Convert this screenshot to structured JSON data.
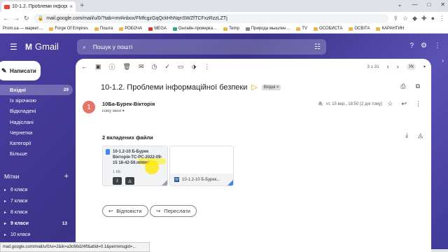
{
  "browser": {
    "tab_title": "10-1.2. Проблеми інформаційної",
    "tab_close": "×",
    "new_tab": "+",
    "url": "mail.google.com/mail/u/0/?tab=rm#inbox/FMfcgzGqQckHhNqnSWZfTCFxzRzzLZTj",
    "window_controls": [
      "⌄",
      "—",
      "□",
      "✕"
    ],
    "bookmarks": [
      "Prom.ua — маркет…",
      "Forge Of Empires",
      "Пошта",
      "РОБОЧА",
      "MEGA",
      "Онлайн-проверка…",
      "Temp",
      "Природа мышлен…",
      "TV",
      "ОСОБИСТА",
      "ОСВІТА",
      "КАРАНТИН"
    ]
  },
  "gmail": {
    "logo_text": "Gmail",
    "search_placeholder": "Пошук у пошті",
    "compose_label": "Написати",
    "nav": [
      {
        "label": "Вхідні",
        "count": "29"
      },
      {
        "label": "Із зірочкою",
        "count": ""
      },
      {
        "label": "Відкладені",
        "count": ""
      },
      {
        "label": "Надіслані",
        "count": ""
      },
      {
        "label": "Чернетки",
        "count": ""
      },
      {
        "label": "Категорії",
        "count": ""
      },
      {
        "label": "Більше",
        "count": ""
      }
    ],
    "labels_header": "Мітки",
    "labels": [
      {
        "label": "6 класи",
        "count": ""
      },
      {
        "label": "7 класи",
        "count": ""
      },
      {
        "label": "8 класи",
        "count": ""
      },
      {
        "label": "9 класи",
        "count": "13"
      },
      {
        "label": "10 класи",
        "count": ""
      }
    ],
    "pager": "3 з 31",
    "lang_badge": "Ук"
  },
  "email": {
    "subject": "10-1.2. Проблеми інформаційної безпеки",
    "inbox_badge": "Вхідні ×",
    "avatar_letter": "1",
    "sender": "10Ба-Бурек-Вікторія",
    "to_me": "кому мені ▾",
    "date": "чт, 15 вер., 18:50 (2 дні тому)",
    "attachments_header": "2 вкладених файли",
    "attachment1": {
      "name": "10-1.2-10 Б-Бурек Вікторія-ТС-РС-2022-09-15 18-42-59.mhtml",
      "size": "1 КБ"
    },
    "attachment2": {
      "name": "10-1.2-10 Б-Бурек..."
    },
    "reply_label": "Відповісти",
    "forward_label": "Переслати"
  },
  "status_url": "mail.google.com/mail/u/0/ui=2&ik=a3c66d24ff&attid=0.1&permmsgid=..."
}
